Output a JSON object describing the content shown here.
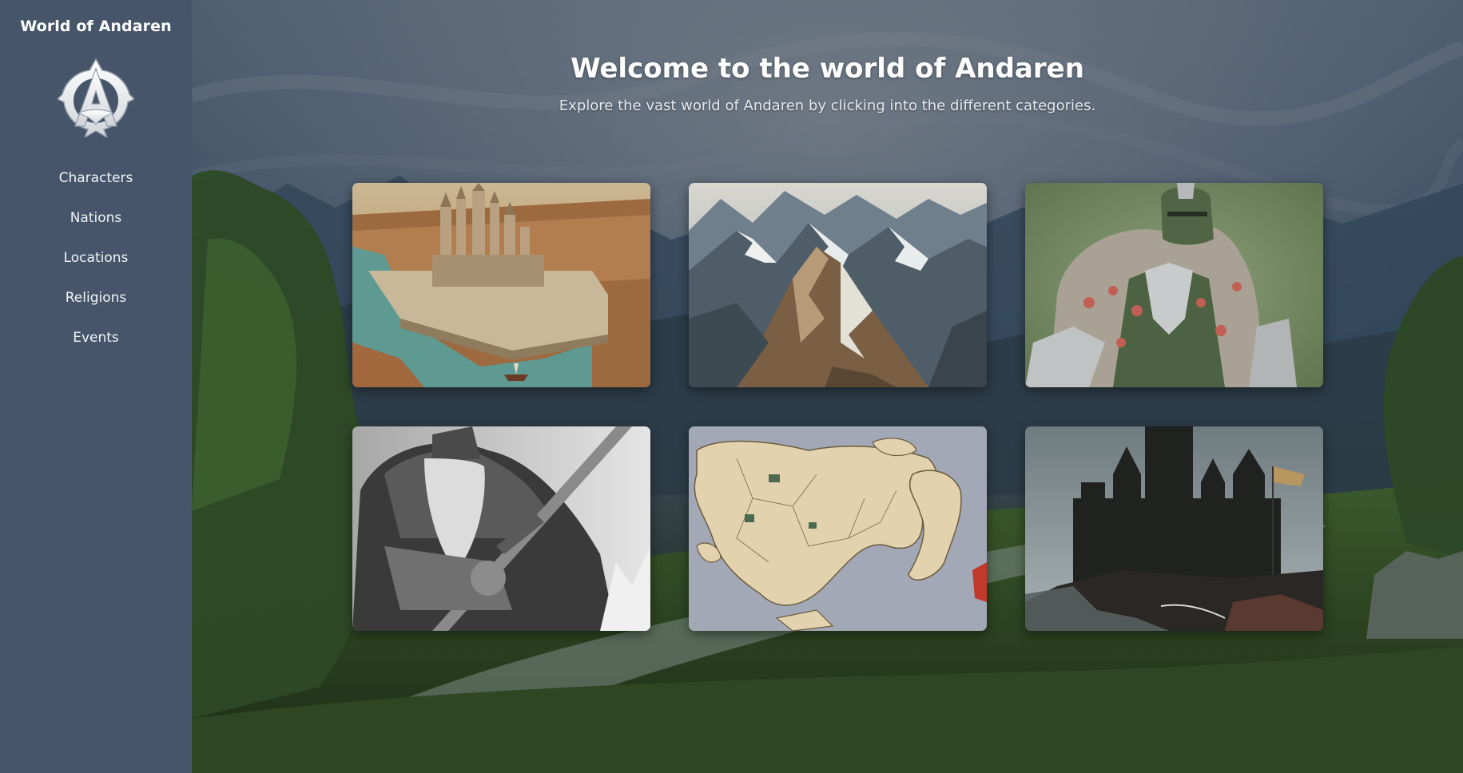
{
  "sidebar": {
    "brand": "World of Andaren",
    "logo_icon": "andaren-emblem-icon",
    "items": [
      {
        "label": "Characters"
      },
      {
        "label": "Nations"
      },
      {
        "label": "Locations"
      },
      {
        "label": "Religions"
      },
      {
        "label": "Events"
      }
    ]
  },
  "main": {
    "title": "Welcome to the world of Andaren",
    "subtitle": "Explore the vast world of Andaren by clicking into the different categories."
  },
  "colors": {
    "sidebar_bg": "#46556a",
    "title_text": "#ffffff",
    "subtitle_text": "#e6e8ec"
  },
  "cards": [
    {
      "image": "walled-city-image"
    },
    {
      "image": "mountain-range-image"
    },
    {
      "image": "armored-knight-image"
    },
    {
      "image": "bearded-warrior-image"
    },
    {
      "image": "world-map-image"
    },
    {
      "image": "dark-castle-image"
    }
  ]
}
